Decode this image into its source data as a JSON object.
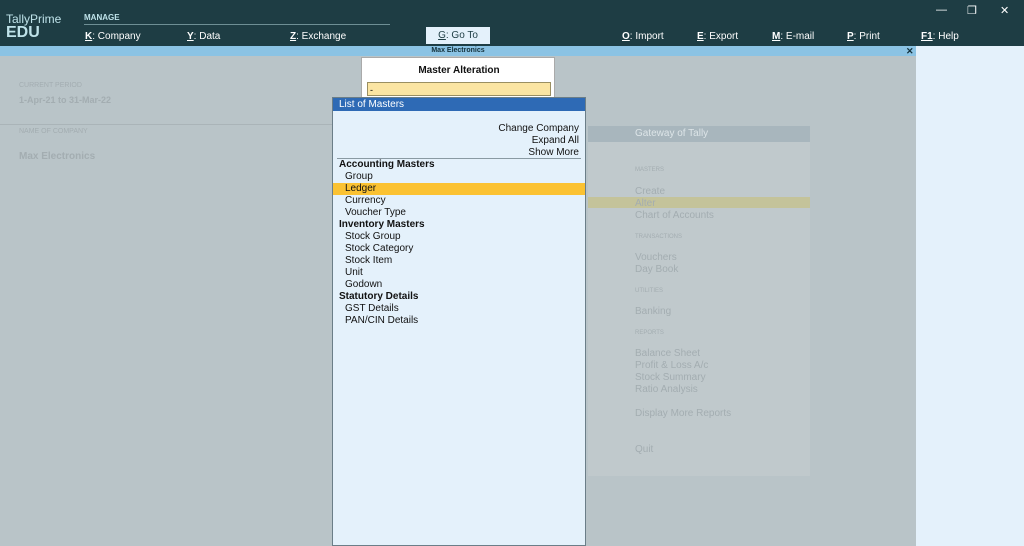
{
  "app": {
    "name": "TallyPrime",
    "edition": "EDU"
  },
  "header": {
    "section": "MANAGE",
    "menu": [
      {
        "key": "K",
        "label": ": Company"
      },
      {
        "key": "Y",
        "label": ": Data"
      },
      {
        "key": "Z",
        "label": ": Exchange"
      },
      {
        "key": "O",
        "label": ": Import"
      },
      {
        "key": "E",
        "label": ": Export"
      },
      {
        "key": "M",
        "label": ": E-mail"
      },
      {
        "key": "P",
        "label": ": Print"
      },
      {
        "key": "F1",
        "label": ": Help"
      }
    ],
    "goto": {
      "key": "G",
      "label": ": Go To"
    },
    "window_controls": {
      "minimize": "—",
      "restore": "❐",
      "close": "✕"
    }
  },
  "window_title": "Max Electronics",
  "close_symbol": "✕",
  "background": {
    "current_period_label": "CURRENT PERIOD",
    "current_period_value": "1-Apr-21 to 31-Mar-22",
    "company_label": "NAME OF COMPANY",
    "company_value": "Max Electronics",
    "gateway": {
      "title": "Gateway of Tally",
      "sections": [
        {
          "header": "MASTERS",
          "items": [
            "Create",
            "Alter",
            "Chart of Accounts"
          ]
        },
        {
          "header": "TRANSACTIONS",
          "items": [
            "Vouchers",
            "Day Book"
          ]
        },
        {
          "header": "UTILITIES",
          "items": [
            "Banking"
          ]
        },
        {
          "header": "REPORTS",
          "items": [
            "Balance Sheet",
            "Profit & Loss A/c",
            "Stock Summary",
            "Ratio Analysis"
          ]
        }
      ],
      "display_more": "Display More Reports",
      "quit": "Quit"
    }
  },
  "master_alteration": {
    "title": "Master Alteration",
    "input_value": "-"
  },
  "list_of_masters": {
    "title": "List of Masters",
    "actions": [
      "Change Company",
      "Expand All",
      "Show More"
    ],
    "groups": [
      {
        "header": "Accounting Masters",
        "items": [
          "Group",
          "Ledger",
          "Currency",
          "Voucher Type"
        ]
      },
      {
        "header": "Inventory Masters",
        "items": [
          "Stock Group",
          "Stock Category",
          "Stock Item",
          "Unit",
          "Godown"
        ]
      },
      {
        "header": "Statutory Details",
        "items": [
          "GST Details",
          "PAN/CIN Details"
        ]
      }
    ],
    "selected_item": "Ledger"
  }
}
